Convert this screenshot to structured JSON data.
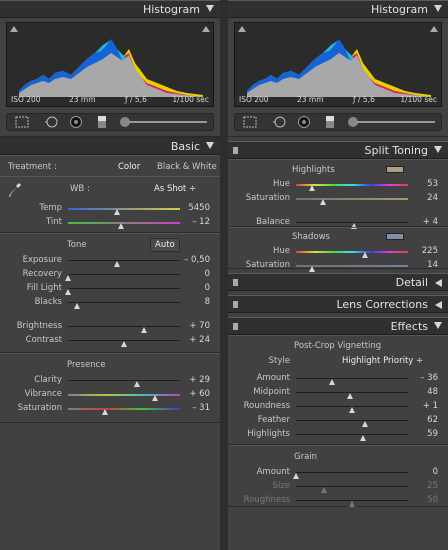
{
  "left": {
    "histogram": {
      "title": "Histogram",
      "iso": "ISO 200",
      "focal": "23 mm",
      "aperture": "ƒ / 5,6",
      "shutter": "1/100 sec"
    },
    "basic": {
      "title": "Basic",
      "treatment_label": "Treatment :",
      "color_label": "Color",
      "bw_label": "Black & White",
      "wb_label": "WB :",
      "wb_value": "As Shot ÷",
      "temp": {
        "label": "Temp",
        "value": "5450",
        "pos": 0.44
      },
      "tint": {
        "label": "Tint",
        "value": "– 12",
        "pos": 0.47
      },
      "tone_label": "Tone",
      "auto_label": "Auto",
      "exposure": {
        "label": "Exposure",
        "value": "– 0,50",
        "pos": 0.44
      },
      "recovery": {
        "label": "Recovery",
        "value": "0",
        "pos": 0.0
      },
      "fill_light": {
        "label": "Fill Light",
        "value": "0",
        "pos": 0.0
      },
      "blacks": {
        "label": "Blacks",
        "value": "8",
        "pos": 0.08
      },
      "brightness": {
        "label": "Brightness",
        "value": "+ 70",
        "pos": 0.68
      },
      "contrast": {
        "label": "Contrast",
        "value": "+ 24",
        "pos": 0.5
      },
      "presence_label": "Presence",
      "clarity": {
        "label": "Clarity",
        "value": "+ 29",
        "pos": 0.62
      },
      "vibrance": {
        "label": "Vibrance",
        "value": "+ 60",
        "pos": 0.78
      },
      "saturation": {
        "label": "Saturation",
        "value": "– 31",
        "pos": 0.33
      }
    }
  },
  "right": {
    "histogram": {
      "title": "Histogram",
      "iso": "ISO 200",
      "focal": "23 mm",
      "aperture": "ƒ / 5,6",
      "shutter": "1/100 sec"
    },
    "split": {
      "title": "Split Toning",
      "highlights_label": "Highlights",
      "h_hue": {
        "label": "Hue",
        "value": "53",
        "pos": 0.14
      },
      "h_sat": {
        "label": "Saturation",
        "value": "24",
        "pos": 0.24
      },
      "balance": {
        "label": "Balance",
        "value": "+ 4",
        "pos": 0.52
      },
      "shadows_label": "Shadows",
      "s_hue": {
        "label": "Hue",
        "value": "225",
        "pos": 0.62
      },
      "s_sat": {
        "label": "Saturation",
        "value": "14",
        "pos": 0.14
      },
      "highlight_color": "#a8a080",
      "shadow_color": "#8090a8"
    },
    "detail": {
      "title": "Detail"
    },
    "lens": {
      "title": "Lens Corrections"
    },
    "effects": {
      "title": "Effects",
      "vignette_label": "Post-Crop Vignetting",
      "style_label": "Style",
      "style_value": "Highlight Priority ÷",
      "amount": {
        "label": "Amount",
        "value": "– 36",
        "pos": 0.32
      },
      "midpoint": {
        "label": "Midpoint",
        "value": "48",
        "pos": 0.48
      },
      "roundness": {
        "label": "Roundness",
        "value": "+ 1",
        "pos": 0.5
      },
      "feather": {
        "label": "Feather",
        "value": "62",
        "pos": 0.62
      },
      "highlights": {
        "label": "Highlights",
        "value": "59",
        "pos": 0.6
      },
      "grain_label": "Grain",
      "g_amount": {
        "label": "Amount",
        "value": "0",
        "pos": 0.0
      },
      "g_size": {
        "label": "Size",
        "value": "25",
        "pos": 0.25
      },
      "g_rough": {
        "label": "Roughness",
        "value": "50",
        "pos": 0.5
      }
    }
  }
}
